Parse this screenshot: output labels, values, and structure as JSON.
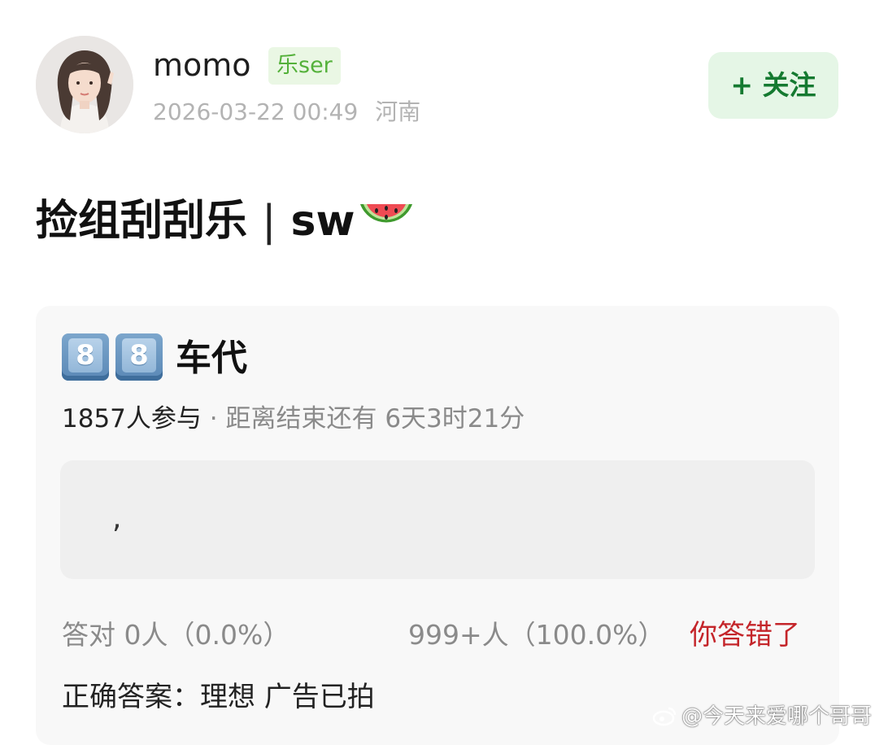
{
  "author": {
    "name": "momo",
    "badge": "乐ser",
    "date": "2026-03-22 00:49",
    "location": "河南"
  },
  "follow_label": "+ 关注",
  "post": {
    "title": "捡组刮刮乐",
    "separator": "|",
    "title_suffix": "sw"
  },
  "quiz": {
    "keycaps": [
      "8",
      "8"
    ],
    "title": "车代",
    "participants": "1857人参与",
    "deadline": "· 距离结束还有 6天3时21分",
    "answer_text": ",",
    "correct_stat": "答对 0人（0.0%）",
    "wrong_stat": "999+人（100.0%）",
    "result": "你答错了",
    "correct_answer": "正确答案：理想 广告已拍"
  },
  "watermark": "@今天来爱哪个哥哥",
  "colors": {
    "badge_green": "#54b13a",
    "follow_green": "#157a31",
    "wrong_red": "#c4252a"
  },
  "icons": [
    "watermelon-emoji",
    "keycap-8-emoji",
    "weibo-icon"
  ]
}
